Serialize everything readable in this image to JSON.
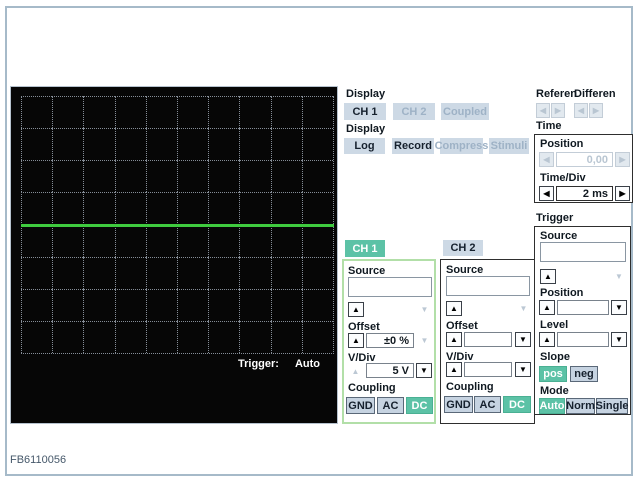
{
  "colors": {
    "teal": "#5cc2a6",
    "button_bg": "#cdd9e5",
    "disabled_text": "#9eb2c6",
    "panel_border_green": "#b2dfa8",
    "trace_green": "#3fcb3f",
    "frame_border": "#a6bac9"
  },
  "icons": {
    "up": "▲",
    "down": "▼",
    "left": "◀",
    "right": "▶"
  },
  "page": {
    "figure_id": "FB6110056"
  },
  "scope": {
    "status_label": "Trigger:",
    "status_value": "Auto",
    "grid": {
      "cols": 10,
      "rows": 8
    }
  },
  "display_channels": {
    "label": "Display",
    "buttons": [
      {
        "label": "CH 1"
      },
      {
        "label": "CH 2"
      },
      {
        "label": "Coupled"
      }
    ]
  },
  "display_modes": {
    "label": "Display",
    "buttons": [
      {
        "label": "Log"
      },
      {
        "label": "Record"
      },
      {
        "label": "Compress"
      },
      {
        "label": "Stimuli"
      }
    ]
  },
  "reference": {
    "label": "Referen"
  },
  "difference": {
    "label": "Differen"
  },
  "time": {
    "label": "Time",
    "position_label": "Position",
    "position_value": "0,00",
    "timediv_label": "Time/Div",
    "timediv_value": "2 ms"
  },
  "trigger": {
    "label": "Trigger",
    "source_label": "Source",
    "source_value": "",
    "position_label": "Position",
    "position_value": "",
    "level_label": "Level",
    "level_value": "",
    "slope_label": "Slope",
    "slope_pos": "pos",
    "slope_neg": "neg",
    "mode_label": "Mode",
    "mode_auto": "Auto",
    "mode_norm": "Norm",
    "mode_single": "Single"
  },
  "ch1": {
    "tab": "CH 1",
    "source_label": "Source",
    "source_value": "",
    "offset_label": "Offset",
    "offset_value": "±0 %",
    "vdiv_label": "V/Div",
    "vdiv_value": "5 V",
    "coupling_label": "Coupling",
    "gnd": "GND",
    "ac": "AC",
    "dc": "DC"
  },
  "ch2": {
    "tab": "CH 2",
    "source_label": "Source",
    "source_value": "",
    "offset_label": "Offset",
    "offset_value": "",
    "vdiv_label": "V/Div",
    "vdiv_value": "",
    "coupling_label": "Coupling",
    "gnd": "GND",
    "ac": "AC",
    "dc": "DC"
  }
}
